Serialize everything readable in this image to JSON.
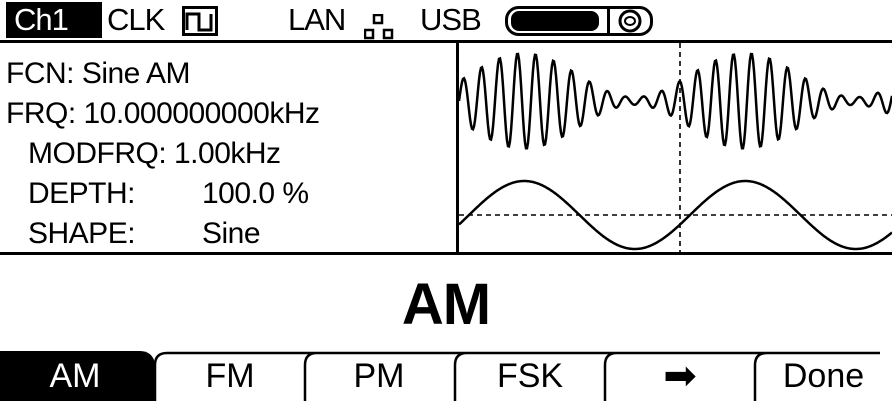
{
  "status_bar": {
    "channel": "Ch1",
    "clk": "CLK",
    "lan": "LAN",
    "usb": "USB",
    "clock_icon": "square-wave-icon",
    "lan_icon": "network-icon",
    "usb_icon": "usb-stick-icon"
  },
  "params": {
    "fcn": "FCN: Sine AM",
    "frq": "FRQ: 10.000000000kHz",
    "modfrq": "MODFRQ: 1.00kHz",
    "depth_label": "DEPTH:",
    "depth_value": "100.0 %",
    "shape_label": "SHAPE:",
    "shape_value": "Sine"
  },
  "mode_title": "AM",
  "softkeys": [
    {
      "label": "AM",
      "selected": true
    },
    {
      "label": "FM",
      "selected": false
    },
    {
      "label": "PM",
      "selected": false
    },
    {
      "label": "FSK",
      "selected": false
    },
    {
      "label": "➡",
      "icon": "right-arrow-icon",
      "selected": false
    },
    {
      "label": "Done",
      "selected": false
    }
  ],
  "colors": {
    "foreground": "#000000",
    "background": "#ffffff"
  }
}
